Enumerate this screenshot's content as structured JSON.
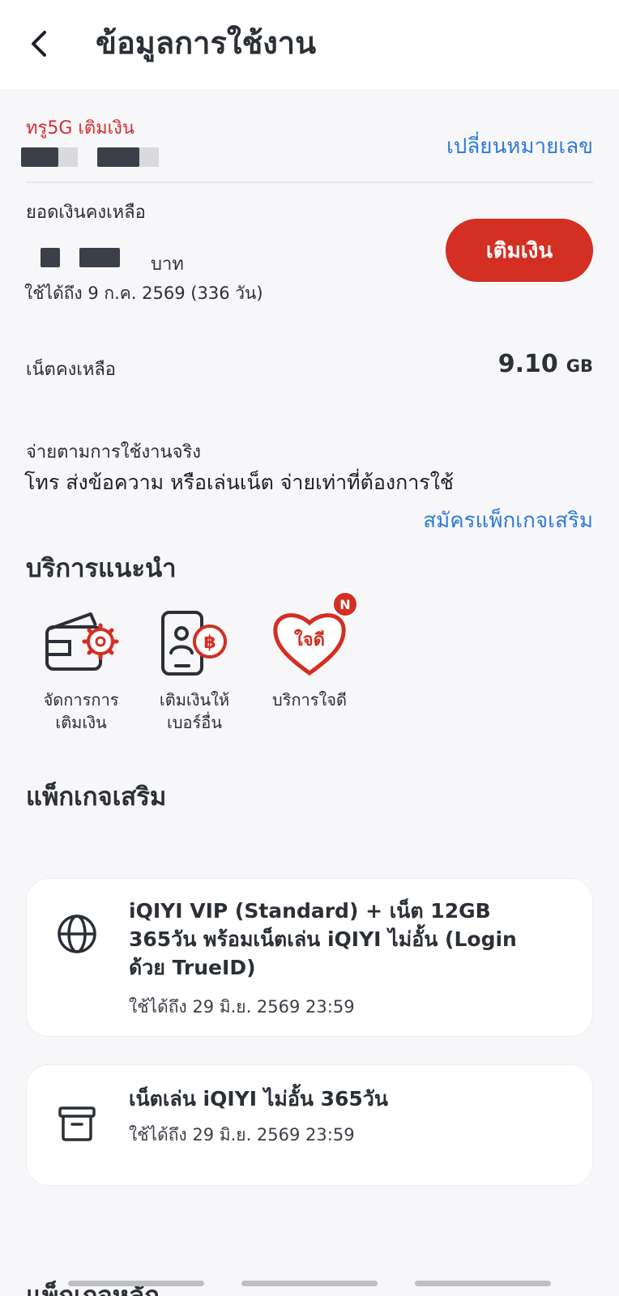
{
  "header": {
    "title": "ข้อมูลการใช้งาน",
    "back_icon": "chevron-left-icon"
  },
  "account": {
    "plan_name": "ทรู5G เติมเงิน",
    "change_number_label": "เปลี่ยนหมายเลข"
  },
  "balance": {
    "label": "ยอดเงินคงเหลือ",
    "unit": "บาท",
    "validity": "ใช้ได้ถึง 9 ก.ค. 2569 (336 วัน)",
    "topup_label": "เติมเงิน"
  },
  "net": {
    "label": "เน็ตคงเหลือ",
    "value": "9.10",
    "unit": "GB"
  },
  "payg": {
    "title": "จ่ายตามการใช้งานจริง",
    "description": "โทร ส่งข้อความ หรือเล่นเน็ต จ่ายเท่าที่ต้องการใช้",
    "subscribe_link": "สมัครแพ็กเกจเสริม"
  },
  "recommended": {
    "title": "บริการแนะนำ",
    "items": [
      {
        "label_line1": "จัดการการ",
        "label_line2": "เติมเงิน",
        "icon": "wallet-gear-icon"
      },
      {
        "label_line1": "เติมเงินให้",
        "label_line2": "เบอร์อื่น",
        "icon": "phone-baht-icon"
      },
      {
        "label_line1": "บริการใจดี",
        "label_line2": "",
        "icon": "heart-jaidee-icon",
        "icon_text": "ใจดี",
        "badge": "N"
      }
    ]
  },
  "addon": {
    "title": "แพ็กเกจเสริม",
    "packages": [
      {
        "name": "iQIYI VIP (Standard) + เน็ต 12GB 365วัน พร้อมเน็ตเล่น iQIYI ไม่อั้น (Login ด้วย TrueID)",
        "validity": "ใช้ได้ถึง 29 มิ.ย. 2569 23:59",
        "icon": "globe-icon"
      },
      {
        "name": "เน็ตเล่น iQIYI ไม่อั้น 365วัน",
        "validity": "ใช้ได้ถึง 29 มิ.ย. 2569 23:59",
        "icon": "archive-box-icon"
      }
    ]
  },
  "main_package": {
    "title": "แพ็กเกจหลัก"
  },
  "colors": {
    "accent_red": "#d32f22",
    "link_blue": "#2f7bd6",
    "background": "#f7f7f9"
  }
}
